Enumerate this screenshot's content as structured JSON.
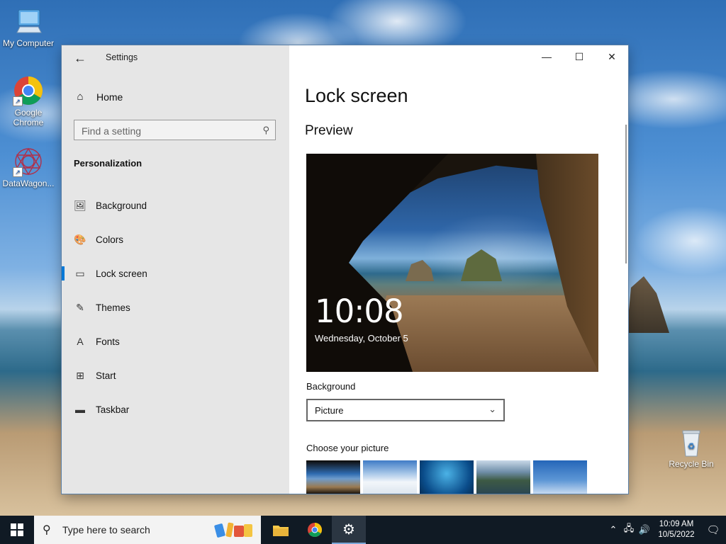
{
  "desktop": {
    "icons": [
      {
        "label": "My Computer"
      },
      {
        "label": "Google Chrome"
      },
      {
        "label": "DataWagon..."
      },
      {
        "label": "Recycle Bin"
      }
    ]
  },
  "window": {
    "title": "Settings",
    "controls": {
      "minimize": "—",
      "maximize": "☐",
      "close": "✕"
    }
  },
  "nav": {
    "home_label": "Home",
    "search": {
      "placeholder": "Find a setting"
    },
    "section": "Personalization",
    "items": [
      {
        "label": "Background",
        "icon": "picture-icon"
      },
      {
        "label": "Colors",
        "icon": "palette-icon"
      },
      {
        "label": "Lock screen",
        "icon": "lock-screen-icon",
        "active": true
      },
      {
        "label": "Themes",
        "icon": "brush-icon"
      },
      {
        "label": "Fonts",
        "icon": "fonts-icon"
      },
      {
        "label": "Start",
        "icon": "start-grid-icon"
      },
      {
        "label": "Taskbar",
        "icon": "taskbar-icon"
      }
    ]
  },
  "content": {
    "title": "Lock screen",
    "preview_heading": "Preview",
    "preview": {
      "time": "10:08",
      "date": "Wednesday, October 5"
    },
    "background_label": "Background",
    "background_value": "Picture",
    "choose_label": "Choose your picture"
  },
  "taskbar": {
    "search_placeholder": "Type here to search",
    "clock_time": "10:09 AM",
    "clock_date": "10/5/2022",
    "accent": "#0078d7"
  }
}
